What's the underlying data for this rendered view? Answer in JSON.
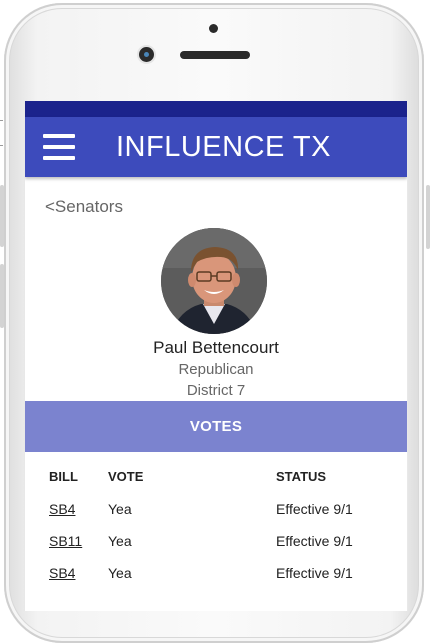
{
  "app": {
    "title": "INFLUENCE TX"
  },
  "nav": {
    "back_label": "<Senators"
  },
  "senator": {
    "name": "Paul Bettencourt",
    "party": "Republican",
    "district": "District 7"
  },
  "votes": {
    "section_label": "VOTES",
    "columns": {
      "bill": "BILL",
      "vote": "VOTE",
      "status": "STATUS"
    },
    "rows": [
      {
        "bill": "SB4",
        "vote": "Yea",
        "status": "Effective 9/1"
      },
      {
        "bill": "SB11",
        "vote": "Yea",
        "status": "Effective 9/1"
      },
      {
        "bill": "SB4",
        "vote": "Yea",
        "status": "Effective 9/1"
      }
    ]
  },
  "colors": {
    "status_bar": "#1b238c",
    "app_bar": "#3d4bbc",
    "votes_bar": "#7b83cf"
  },
  "icons": {
    "menu": "hamburger-menu-icon"
  }
}
